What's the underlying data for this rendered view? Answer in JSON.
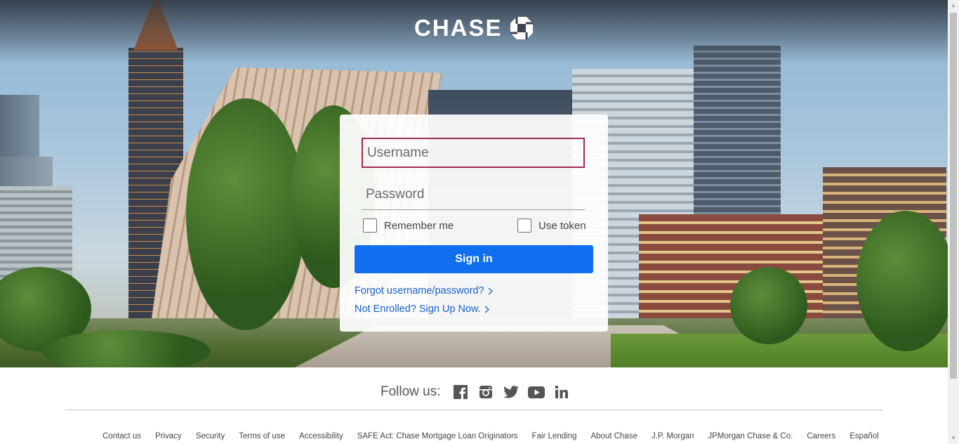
{
  "brand": {
    "name": "CHASE",
    "logo_icon": "chase-octagon-icon"
  },
  "login": {
    "username_placeholder": "Username",
    "password_placeholder": "Password",
    "remember_label": "Remember me",
    "token_label": "Use token",
    "signin_label": "Sign in",
    "forgot_label": "Forgot username/password?",
    "enroll_label": "Not Enrolled? Sign Up Now."
  },
  "follow": {
    "label": "Follow us:",
    "icons": [
      "facebook-icon",
      "instagram-icon",
      "twitter-icon",
      "youtube-icon",
      "linkedin-icon"
    ]
  },
  "footer": {
    "links": [
      "Contact us",
      "Privacy",
      "Security",
      "Terms of use",
      "Accessibility",
      "SAFE Act: Chase Mortgage Loan Originators",
      "Fair Lending",
      "About Chase",
      "J.P. Morgan",
      "JPMorgan Chase & Co.",
      "Careers",
      "Español"
    ]
  },
  "colors": {
    "accent": "#0f6ff0",
    "link": "#1860c8",
    "focus_border": "#a12a57"
  }
}
